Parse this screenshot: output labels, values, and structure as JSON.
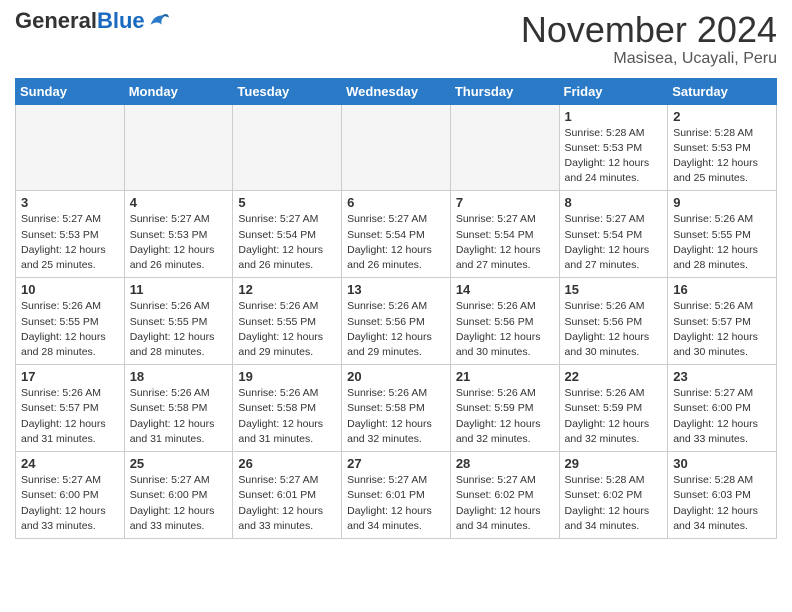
{
  "header": {
    "logo_general": "General",
    "logo_blue": "Blue",
    "month": "November 2024",
    "location": "Masisea, Ucayali, Peru"
  },
  "weekdays": [
    "Sunday",
    "Monday",
    "Tuesday",
    "Wednesday",
    "Thursday",
    "Friday",
    "Saturday"
  ],
  "weeks": [
    [
      {
        "day": "",
        "info": ""
      },
      {
        "day": "",
        "info": ""
      },
      {
        "day": "",
        "info": ""
      },
      {
        "day": "",
        "info": ""
      },
      {
        "day": "",
        "info": ""
      },
      {
        "day": "1",
        "info": "Sunrise: 5:28 AM\nSunset: 5:53 PM\nDaylight: 12 hours\nand 24 minutes."
      },
      {
        "day": "2",
        "info": "Sunrise: 5:28 AM\nSunset: 5:53 PM\nDaylight: 12 hours\nand 25 minutes."
      }
    ],
    [
      {
        "day": "3",
        "info": "Sunrise: 5:27 AM\nSunset: 5:53 PM\nDaylight: 12 hours\nand 25 minutes."
      },
      {
        "day": "4",
        "info": "Sunrise: 5:27 AM\nSunset: 5:53 PM\nDaylight: 12 hours\nand 26 minutes."
      },
      {
        "day": "5",
        "info": "Sunrise: 5:27 AM\nSunset: 5:54 PM\nDaylight: 12 hours\nand 26 minutes."
      },
      {
        "day": "6",
        "info": "Sunrise: 5:27 AM\nSunset: 5:54 PM\nDaylight: 12 hours\nand 26 minutes."
      },
      {
        "day": "7",
        "info": "Sunrise: 5:27 AM\nSunset: 5:54 PM\nDaylight: 12 hours\nand 27 minutes."
      },
      {
        "day": "8",
        "info": "Sunrise: 5:27 AM\nSunset: 5:54 PM\nDaylight: 12 hours\nand 27 minutes."
      },
      {
        "day": "9",
        "info": "Sunrise: 5:26 AM\nSunset: 5:55 PM\nDaylight: 12 hours\nand 28 minutes."
      }
    ],
    [
      {
        "day": "10",
        "info": "Sunrise: 5:26 AM\nSunset: 5:55 PM\nDaylight: 12 hours\nand 28 minutes."
      },
      {
        "day": "11",
        "info": "Sunrise: 5:26 AM\nSunset: 5:55 PM\nDaylight: 12 hours\nand 28 minutes."
      },
      {
        "day": "12",
        "info": "Sunrise: 5:26 AM\nSunset: 5:55 PM\nDaylight: 12 hours\nand 29 minutes."
      },
      {
        "day": "13",
        "info": "Sunrise: 5:26 AM\nSunset: 5:56 PM\nDaylight: 12 hours\nand 29 minutes."
      },
      {
        "day": "14",
        "info": "Sunrise: 5:26 AM\nSunset: 5:56 PM\nDaylight: 12 hours\nand 30 minutes."
      },
      {
        "day": "15",
        "info": "Sunrise: 5:26 AM\nSunset: 5:56 PM\nDaylight: 12 hours\nand 30 minutes."
      },
      {
        "day": "16",
        "info": "Sunrise: 5:26 AM\nSunset: 5:57 PM\nDaylight: 12 hours\nand 30 minutes."
      }
    ],
    [
      {
        "day": "17",
        "info": "Sunrise: 5:26 AM\nSunset: 5:57 PM\nDaylight: 12 hours\nand 31 minutes."
      },
      {
        "day": "18",
        "info": "Sunrise: 5:26 AM\nSunset: 5:58 PM\nDaylight: 12 hours\nand 31 minutes."
      },
      {
        "day": "19",
        "info": "Sunrise: 5:26 AM\nSunset: 5:58 PM\nDaylight: 12 hours\nand 31 minutes."
      },
      {
        "day": "20",
        "info": "Sunrise: 5:26 AM\nSunset: 5:58 PM\nDaylight: 12 hours\nand 32 minutes."
      },
      {
        "day": "21",
        "info": "Sunrise: 5:26 AM\nSunset: 5:59 PM\nDaylight: 12 hours\nand 32 minutes."
      },
      {
        "day": "22",
        "info": "Sunrise: 5:26 AM\nSunset: 5:59 PM\nDaylight: 12 hours\nand 32 minutes."
      },
      {
        "day": "23",
        "info": "Sunrise: 5:27 AM\nSunset: 6:00 PM\nDaylight: 12 hours\nand 33 minutes."
      }
    ],
    [
      {
        "day": "24",
        "info": "Sunrise: 5:27 AM\nSunset: 6:00 PM\nDaylight: 12 hours\nand 33 minutes."
      },
      {
        "day": "25",
        "info": "Sunrise: 5:27 AM\nSunset: 6:00 PM\nDaylight: 12 hours\nand 33 minutes."
      },
      {
        "day": "26",
        "info": "Sunrise: 5:27 AM\nSunset: 6:01 PM\nDaylight: 12 hours\nand 33 minutes."
      },
      {
        "day": "27",
        "info": "Sunrise: 5:27 AM\nSunset: 6:01 PM\nDaylight: 12 hours\nand 34 minutes."
      },
      {
        "day": "28",
        "info": "Sunrise: 5:27 AM\nSunset: 6:02 PM\nDaylight: 12 hours\nand 34 minutes."
      },
      {
        "day": "29",
        "info": "Sunrise: 5:28 AM\nSunset: 6:02 PM\nDaylight: 12 hours\nand 34 minutes."
      },
      {
        "day": "30",
        "info": "Sunrise: 5:28 AM\nSunset: 6:03 PM\nDaylight: 12 hours\nand 34 minutes."
      }
    ]
  ]
}
